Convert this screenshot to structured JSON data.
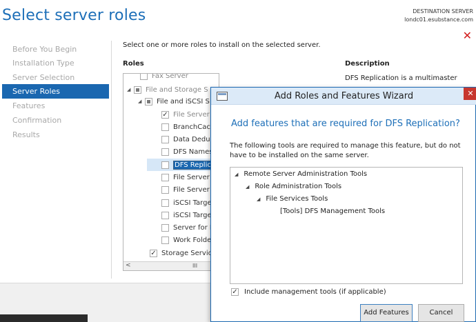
{
  "header": {
    "title": "Select server roles",
    "dest_label": "DESTINATION SERVER",
    "dest_server": "londc01.esubstance.com",
    "close_glyph": "✕"
  },
  "sidebar": {
    "items": [
      {
        "label": "Before You Begin"
      },
      {
        "label": "Installation Type"
      },
      {
        "label": "Server Selection"
      },
      {
        "label": "Server Roles"
      },
      {
        "label": "Features"
      },
      {
        "label": "Confirmation"
      },
      {
        "label": "Results"
      }
    ],
    "active_item": "Server Roles"
  },
  "main": {
    "instruction": "Select one or more roles to install on the selected server.",
    "roles_header": "Roles",
    "description_header": "Description",
    "description_text": "DFS Replication is a multimaster",
    "tree": [
      {
        "label": "Fax Server"
      },
      {
        "label": "File and Storage S"
      },
      {
        "label": "File and iSCSI S"
      },
      {
        "label": "File Server ("
      },
      {
        "label": "BranchCach"
      },
      {
        "label": "Data Dedup"
      },
      {
        "label": "DFS Names"
      },
      {
        "label": "DFS Replica"
      },
      {
        "label": "File Server I"
      },
      {
        "label": "File Server V"
      },
      {
        "label": "iSCSI Targe"
      },
      {
        "label": "iSCSI Targe"
      },
      {
        "label": "Server for N"
      },
      {
        "label": "Work Folde"
      },
      {
        "label": "Storage Service"
      }
    ],
    "scroll_left": "<",
    "scroll_thumb": "III"
  },
  "dialog": {
    "title": "Add Roles and Features Wizard",
    "close_glyph": "✕",
    "heading": "Add features that are required for DFS Replication?",
    "text": "The following tools are required to manage this feature, but do not have to be installed on the same server.",
    "features": [
      {
        "label": "Remote Server Administration Tools"
      },
      {
        "label": "Role Administration Tools"
      },
      {
        "label": "File Services Tools"
      },
      {
        "label": "[Tools] DFS Management Tools"
      }
    ],
    "include_label": "Include management tools (if applicable)",
    "include_checked": true,
    "add_button": "Add Features",
    "cancel_button": "Cancel"
  },
  "colors": {
    "accent": "#1a67b0",
    "title_blue": "#1d6fb8",
    "close_red": "#d21e1e"
  },
  "icons": {
    "expand": "triangle-expanded-icon",
    "check": "checkmark-icon",
    "wizard": "window-icon"
  }
}
